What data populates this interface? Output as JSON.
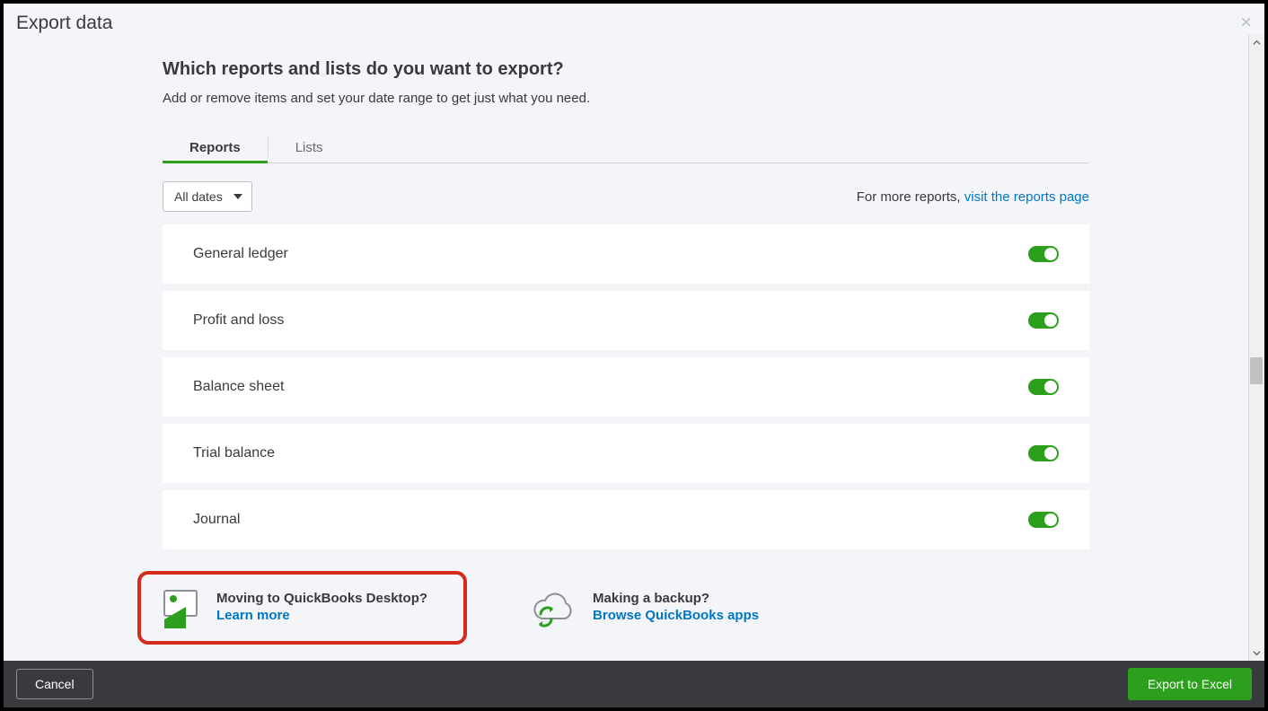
{
  "title": "Export data",
  "heading": "Which reports and lists do you want to export?",
  "subheading": "Add or remove items and set your date range to get just what you need.",
  "tabs": {
    "reports": "Reports",
    "lists": "Lists"
  },
  "date_filter": "All dates",
  "more_reports_prefix": "For more reports, ",
  "more_reports_link": "visit the reports page",
  "reports": {
    "r0": "General ledger",
    "r1": "Profit and loss",
    "r2": "Balance sheet",
    "r3": "Trial balance",
    "r4": "Journal"
  },
  "promo1": {
    "title": "Moving to QuickBooks Desktop?",
    "link": "Learn more"
  },
  "promo2": {
    "title": "Making a backup?",
    "link": "Browse QuickBooks apps"
  },
  "footer": {
    "cancel": "Cancel",
    "export": "Export to Excel"
  }
}
